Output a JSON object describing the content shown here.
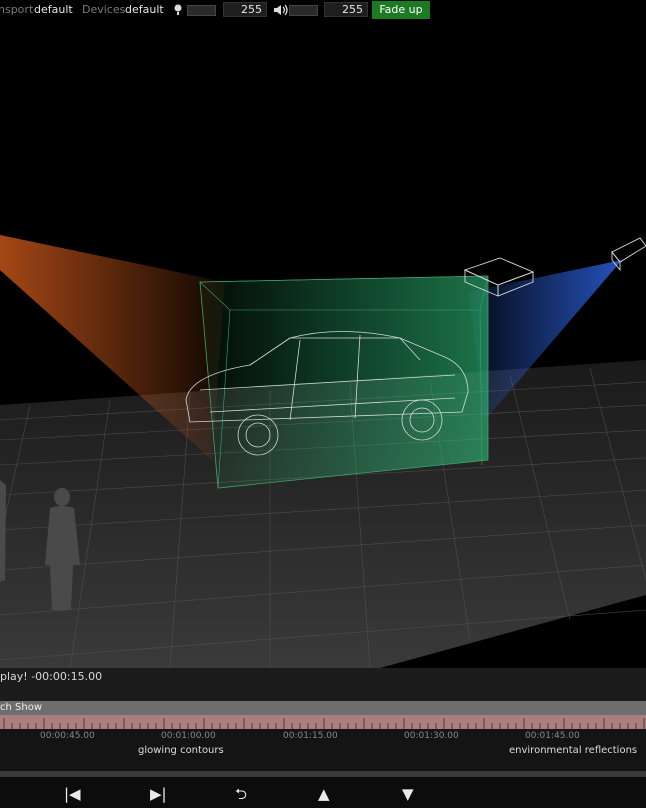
{
  "topbar": {
    "transport_label": "nsport",
    "transport_value": "default",
    "devices_label": "Devices",
    "devices_value": "default",
    "brightness_icon": "lightbulb-icon",
    "brightness_fraction": 0.0,
    "brightness_value": "255",
    "volume_icon": "speaker-icon",
    "volume_fraction": 0.0,
    "volume_value": "255",
    "fade_label": "Fade up",
    "fade_color": "#1b7a22"
  },
  "status": {
    "message": "play! -00:00:15.00"
  },
  "show": {
    "title": "ch Show"
  },
  "timeline": {
    "timecodes": [
      "00:00:45.00",
      "00:01:00.00",
      "00:01:15.00",
      "00:01:30.00",
      "00:01:45.00"
    ],
    "cues": [
      "glowing contours",
      "environmental reflections"
    ],
    "ruler_color": "#a97e7e"
  },
  "transport": {
    "buttons": [
      {
        "name": "skip-back-icon",
        "glyph": "|◀"
      },
      {
        "name": "skip-forward-icon",
        "glyph": "▶|"
      },
      {
        "name": "undo-icon",
        "glyph": "⮌"
      },
      {
        "name": "up-icon",
        "glyph": "▲"
      },
      {
        "name": "down-icon",
        "glyph": "▼"
      }
    ]
  },
  "colors": {
    "projector_left": "#c2541a",
    "projector_right": "#2a5bd0",
    "box_green": "#2fc07a"
  }
}
